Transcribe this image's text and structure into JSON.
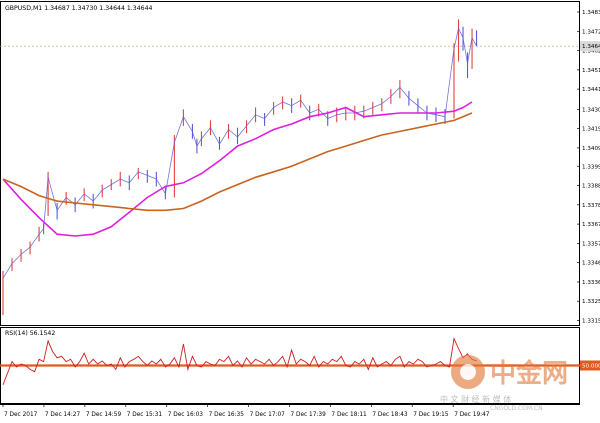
{
  "colors": {
    "background": "#ffffff",
    "frame": "#000000",
    "bull_bar": "#e0443a",
    "bear_bar": "#5a5ad8",
    "ma_fast": "#e01ee0",
    "ma_slow": "#c8641e",
    "rsi_line": "#d01e1e",
    "rsi_level": "#e05a1e",
    "price_tag_bg": "#d8d8d8",
    "watermark": "#e07a3a",
    "watermark_text": "#b0b0b0"
  },
  "main_panel": {
    "header": "GBPUSD,M1  1.34687 1.34730 1.34644 1.34644",
    "current_price_label": "1.34644"
  },
  "rsi_panel": {
    "header": "RSI(14) 56.1542",
    "level_label": "50.0000"
  },
  "watermark": {
    "brand_cn": "中金网",
    "brand_sub": "中 文 财 经 新 媒 体",
    "domain": "CNGOLD.COM.CN"
  },
  "chart_data": [
    {
      "type": "line",
      "title": "GBPUSD,M1",
      "ohlc_header": {
        "open": 1.34687,
        "high": 1.3473,
        "low": 1.34644,
        "close": 1.34644
      },
      "ylim": [
        1.3312,
        1.3489
      ],
      "y_ticks": [
        "1.34830",
        "1.34725",
        "1.34620",
        "1.34515",
        "1.34410",
        "1.34300",
        "1.34195",
        "1.34090",
        "1.33990",
        "1.33885",
        "1.33780",
        "1.33675",
        "1.33570",
        "1.33465",
        "1.33360",
        "1.33255",
        "1.33150"
      ],
      "x_ticks": [
        "7 Dec 2017",
        "7 Dec 14:27",
        "7 Dec 14:59",
        "7 Dec 15:31",
        "7 Dec 16:03",
        "7 Dec 16:35",
        "7 Dec 17:07",
        "7 Dec 17:39",
        "7 Dec 18:11",
        "7 Dec 18:43",
        "7 Dec 19:15",
        "7 Dec 19:47"
      ],
      "x_domain": [
        0,
        100
      ],
      "x_tick_positions": [
        0,
        9.07,
        18.15,
        27.22,
        36.3,
        45.37,
        54.45,
        63.52,
        72.6,
        81.67,
        90.74,
        99.82
      ],
      "series": [
        {
          "name": "Price",
          "x": [
            0,
            2,
            4,
            6,
            8,
            9,
            10,
            12,
            14,
            16,
            18,
            20,
            22,
            24,
            26,
            28,
            30,
            32,
            34,
            36,
            38,
            40,
            42,
            43,
            44,
            46,
            48,
            50,
            52,
            54,
            56,
            58,
            60,
            62,
            64,
            66,
            68,
            70,
            72,
            74,
            76,
            78,
            80,
            82,
            84,
            86,
            88,
            90,
            92,
            94,
            96,
            98,
            100,
            101,
            102,
            103,
            104,
            105
          ],
          "y": [
            1.3338,
            1.3346,
            1.3351,
            1.3355,
            1.3362,
            1.3365,
            1.3393,
            1.3375,
            1.3382,
            1.3378,
            1.3384,
            1.338,
            1.3386,
            1.3389,
            1.3392,
            1.339,
            1.3396,
            1.3394,
            1.3392,
            1.3384,
            1.3412,
            1.3426,
            1.3418,
            1.341,
            1.3414,
            1.342,
            1.3411,
            1.3419,
            1.3415,
            1.3421,
            1.3427,
            1.3425,
            1.3431,
            1.3434,
            1.3432,
            1.3435,
            1.3428,
            1.343,
            1.3425,
            1.3427,
            1.3428,
            1.3428,
            1.3429,
            1.3431,
            1.3433,
            1.3437,
            1.3442,
            1.3436,
            1.3432,
            1.3428,
            1.3427,
            1.3426,
            1.3463,
            1.3474,
            1.3469,
            1.3455,
            1.3469,
            1.34644
          ],
          "high": [
            1.3342,
            1.3349,
            1.3354,
            1.3358,
            1.3366,
            1.3368,
            1.3396,
            1.3379,
            1.3385,
            1.3382,
            1.3387,
            1.3384,
            1.3389,
            1.3392,
            1.3396,
            1.3394,
            1.3398,
            1.3397,
            1.3396,
            1.3388,
            1.3416,
            1.343,
            1.3422,
            1.3414,
            1.3418,
            1.3424,
            1.3415,
            1.3422,
            1.342,
            1.3424,
            1.3431,
            1.3428,
            1.3434,
            1.3437,
            1.3436,
            1.3438,
            1.3432,
            1.3433,
            1.3429,
            1.3431,
            1.3431,
            1.3432,
            1.3432,
            1.3434,
            1.3436,
            1.3441,
            1.3446,
            1.344,
            1.3436,
            1.3432,
            1.3431,
            1.343,
            1.3466,
            1.3479,
            1.3475,
            1.3461,
            1.3474,
            1.3473
          ],
          "low": [
            1.3318,
            1.3342,
            1.3347,
            1.3351,
            1.3358,
            1.3362,
            1.3372,
            1.337,
            1.3378,
            1.3374,
            1.338,
            1.3376,
            1.3382,
            1.3386,
            1.3388,
            1.3386,
            1.3392,
            1.339,
            1.3388,
            1.3381,
            1.3382,
            1.3421,
            1.3414,
            1.3406,
            1.341,
            1.3416,
            1.3408,
            1.3414,
            1.3411,
            1.3417,
            1.3423,
            1.3421,
            1.3427,
            1.343,
            1.3428,
            1.3431,
            1.3424,
            1.3426,
            1.3421,
            1.3423,
            1.3424,
            1.3424,
            1.3425,
            1.3427,
            1.3429,
            1.3433,
            1.3436,
            1.3432,
            1.3428,
            1.3424,
            1.3423,
            1.3422,
            1.3425,
            1.3456,
            1.3462,
            1.3447,
            1.3452,
            1.34644
          ]
        },
        {
          "name": "MA fast",
          "x": [
            0,
            4,
            8,
            12,
            16,
            20,
            24,
            28,
            32,
            36,
            40,
            44,
            48,
            52,
            56,
            60,
            64,
            68,
            72,
            76,
            80,
            84,
            88,
            92,
            96,
            100,
            102,
            104
          ],
          "y": [
            1.3392,
            1.3381,
            1.3371,
            1.3362,
            1.3361,
            1.3362,
            1.3366,
            1.3374,
            1.3382,
            1.3388,
            1.339,
            1.3395,
            1.3402,
            1.341,
            1.3414,
            1.3419,
            1.3422,
            1.3426,
            1.3428,
            1.3431,
            1.3426,
            1.3427,
            1.3428,
            1.3428,
            1.3428,
            1.3429,
            1.3431,
            1.3434
          ]
        },
        {
          "name": "MA slow",
          "x": [
            0,
            4,
            8,
            12,
            16,
            20,
            24,
            28,
            32,
            36,
            40,
            44,
            48,
            52,
            56,
            60,
            64,
            68,
            72,
            76,
            80,
            84,
            88,
            92,
            96,
            100,
            102,
            104
          ],
          "y": [
            1.3392,
            1.3388,
            1.3383,
            1.338,
            1.3379,
            1.3378,
            1.3377,
            1.3376,
            1.3375,
            1.3375,
            1.3376,
            1.338,
            1.3385,
            1.3389,
            1.3393,
            1.3396,
            1.3399,
            1.3403,
            1.3407,
            1.341,
            1.3413,
            1.3416,
            1.3418,
            1.342,
            1.3422,
            1.3424,
            1.3426,
            1.3428
          ]
        }
      ]
    },
    {
      "type": "line",
      "title": "RSI(14) 56.1542",
      "ylim": [
        0,
        100
      ],
      "level": 50,
      "series": [
        {
          "name": "RSI(14)",
          "x": [
            0,
            1,
            2,
            3,
            4,
            5,
            6,
            7,
            8,
            9,
            10,
            11,
            12,
            13,
            14,
            15,
            16,
            17,
            18,
            19,
            20,
            21,
            22,
            23,
            24,
            25,
            26,
            27,
            28,
            29,
            30,
            31,
            32,
            33,
            34,
            35,
            36,
            37,
            38,
            39,
            40,
            41,
            42,
            43,
            44,
            45,
            46,
            47,
            48,
            49,
            50,
            51,
            52,
            53,
            54,
            55,
            56,
            57,
            58,
            59,
            60,
            61,
            62,
            63,
            64,
            65,
            66,
            67,
            68,
            69,
            70,
            71,
            72,
            73,
            74,
            75,
            76,
            77,
            78,
            79,
            80,
            81,
            82,
            83,
            84,
            85,
            86,
            87,
            88,
            89,
            90,
            91,
            92,
            93,
            94,
            95,
            96,
            97,
            98,
            99,
            100,
            101,
            102,
            103,
            104,
            105
          ],
          "y": [
            25,
            40,
            55,
            48,
            52,
            50,
            45,
            42,
            58,
            55,
            82,
            68,
            60,
            62,
            55,
            58,
            48,
            55,
            66,
            52,
            58,
            52,
            56,
            50,
            52,
            45,
            60,
            48,
            55,
            58,
            62,
            55,
            50,
            56,
            52,
            58,
            48,
            52,
            60,
            48,
            78,
            45,
            62,
            50,
            48,
            55,
            52,
            50,
            58,
            55,
            62,
            50,
            56,
            48,
            60,
            52,
            58,
            55,
            52,
            58,
            50,
            55,
            62,
            48,
            70,
            52,
            58,
            55,
            50,
            62,
            48,
            55,
            52,
            58,
            55,
            62,
            50,
            48,
            55,
            52,
            58,
            45,
            60,
            48,
            52,
            55,
            50,
            58,
            62,
            48,
            55,
            52,
            58,
            55,
            48,
            50,
            52,
            55,
            50,
            48,
            85,
            72,
            60,
            65,
            58,
            56
          ]
        }
      ]
    }
  ]
}
